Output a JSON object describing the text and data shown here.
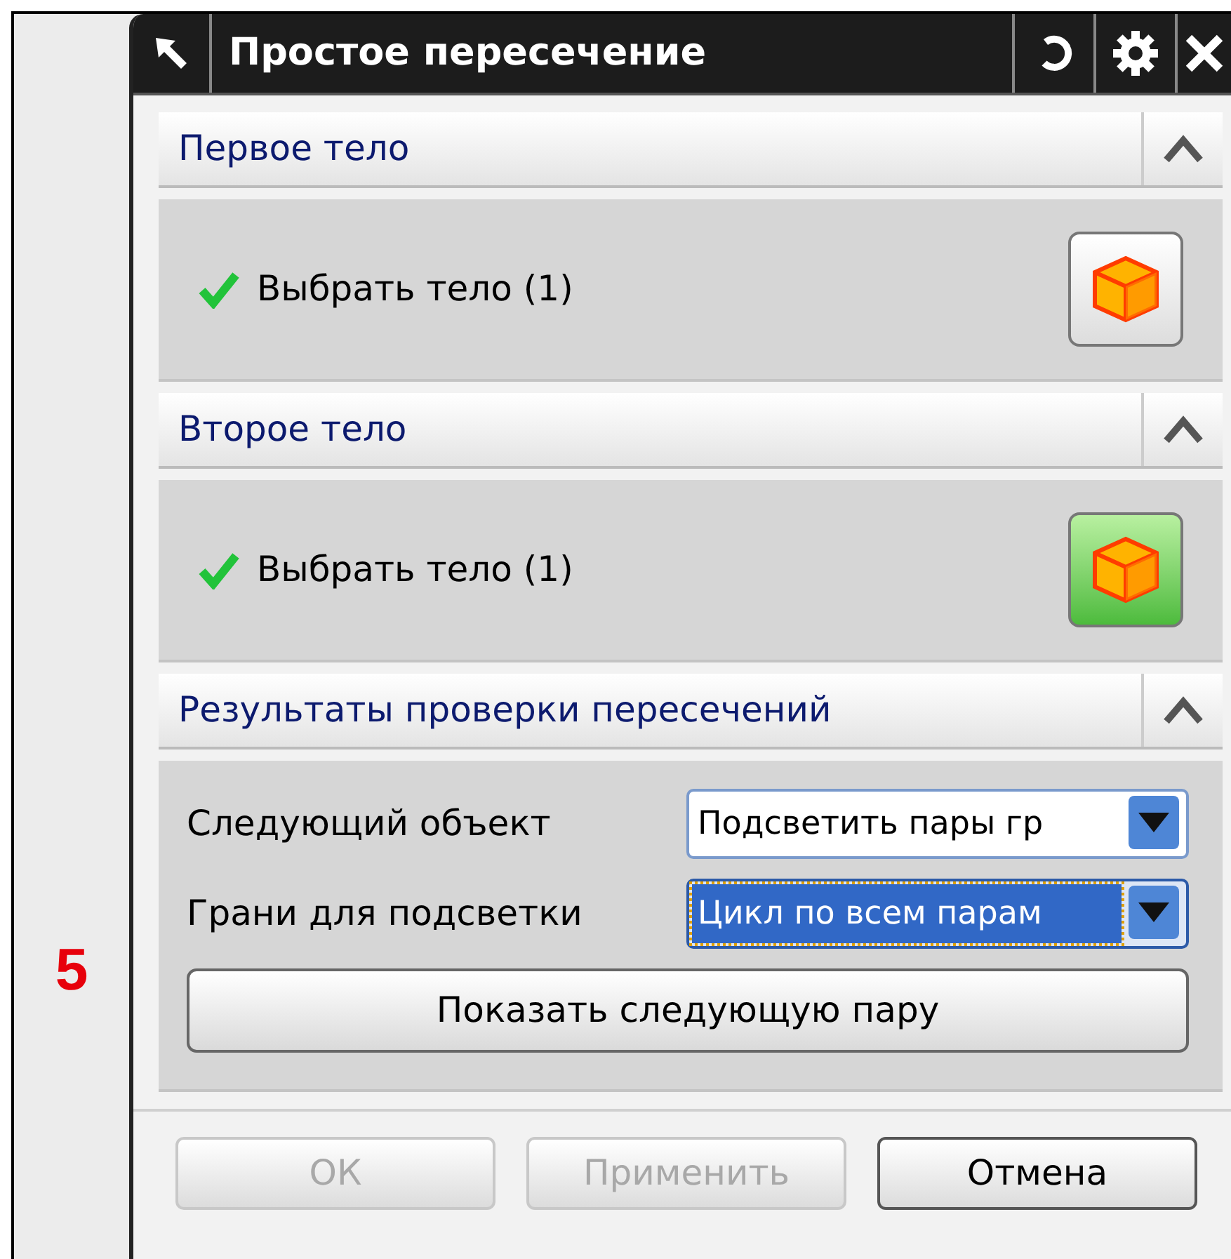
{
  "figure_label": "5",
  "dialog": {
    "title": "Простое пересечение",
    "sections": [
      {
        "kind": "selection",
        "title": "Первое тело",
        "expanded": true,
        "selection": {
          "label": "Выбрать тело (1)",
          "done": true,
          "active": false
        }
      },
      {
        "kind": "selection",
        "title": "Второе тело",
        "expanded": true,
        "selection": {
          "label": "Выбрать тело (1)",
          "done": true,
          "active": true
        }
      },
      {
        "kind": "settings",
        "title": "Результаты проверки пересечений",
        "expanded": true,
        "fields": [
          {
            "label": "Следующий объект",
            "value": "Подсветить пары гр",
            "focused": false
          },
          {
            "label": "Грани для подсветки",
            "value": "Цикл по всем парам",
            "focused": true
          }
        ],
        "action": "Показать следующую пару"
      }
    ],
    "buttons": [
      {
        "label": "ОК",
        "disabled": true
      },
      {
        "label": "Применить",
        "disabled": true
      },
      {
        "label": "Отмена",
        "disabled": false
      }
    ]
  }
}
